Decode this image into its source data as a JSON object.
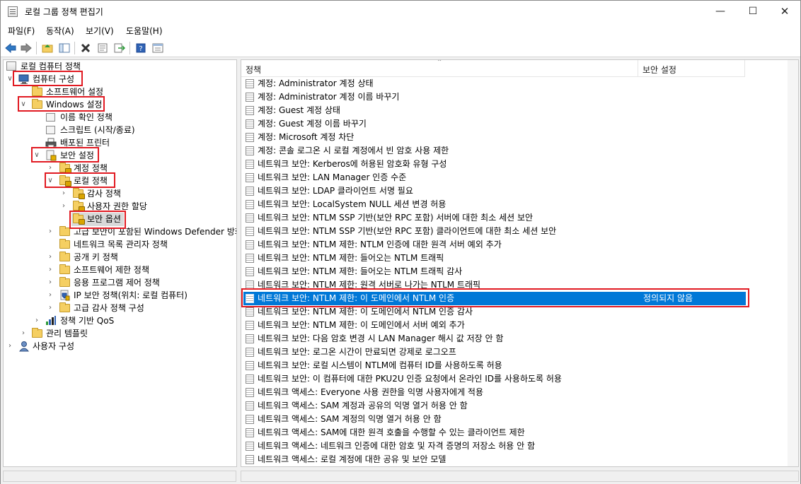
{
  "window": {
    "title": "로컬 그룹 정책 편집기"
  },
  "menu": [
    "파일(F)",
    "동작(A)",
    "보기(V)",
    "도움말(H)"
  ],
  "toolbar": {
    "icons": [
      "back-arrow-icon",
      "forward-arrow-icon",
      "up-folder-icon",
      "show-hide-tree-icon",
      "delete-icon",
      "properties-icon",
      "export-list-icon",
      "help-icon",
      "mmc-view-icon"
    ]
  },
  "tree": {
    "root": "로컬 컴퓨터 정책",
    "computer_config": "컴퓨터 구성",
    "software_settings": "소프트웨어 설정",
    "windows_settings": "Windows 설정",
    "name_resolution": "이름 확인 정책",
    "scripts": "스크립트 (시작/종료)",
    "deployed_printers": "배포된 프린터",
    "security_settings": "보안 설정",
    "account_policies": "계정 정책",
    "local_policies": "로컬 정책",
    "audit_policy": "감사 정책",
    "user_rights": "사용자 권한 할당",
    "security_options": "보안 옵션",
    "wf_advanced": "고급 보안이 포함된 Windows Defender 방화",
    "network_list": "네트워크 목록 관리자 정책",
    "public_key": "공개 키 정책",
    "software_restriction": "소프트웨어 제한 정책",
    "app_control": "응용 프로그램 제어 정책",
    "ipsec": "IP 보안 정책(위치: 로컬 컴퓨터)",
    "advanced_audit": "고급 감사 정책 구성",
    "qos": "정책 기반 QoS",
    "admin_templates": "관리 템플릿",
    "user_config": "사용자 구성"
  },
  "list": {
    "col_policy": "정책",
    "col_setting": "보안 설정",
    "rows": [
      {
        "label": "계정: Administrator 계정 상태",
        "value": ""
      },
      {
        "label": "계정: Administrator 계정 이름 바꾸기",
        "value": ""
      },
      {
        "label": "계정: Guest 계정 상태",
        "value": ""
      },
      {
        "label": "계정: Guest 계정 이름 바꾸기",
        "value": ""
      },
      {
        "label": "계정: Microsoft 계정 차단",
        "value": ""
      },
      {
        "label": "계정: 콘솔 로그온 시 로컬 계정에서 빈 암호 사용 제한",
        "value": ""
      },
      {
        "label": "네트워크 보안: Kerberos에 허용된 암호화 유형 구성",
        "value": ""
      },
      {
        "label": "네트워크 보안: LAN Manager 인증 수준",
        "value": ""
      },
      {
        "label": "네트워크 보안: LDAP 클라이언트 서명 필요",
        "value": ""
      },
      {
        "label": "네트워크 보안: LocalSystem NULL 세션 변경 허용",
        "value": ""
      },
      {
        "label": "네트워크 보안: NTLM SSP 기반(보안 RPC 포함) 서버에 대한 최소 세션 보안",
        "value": ""
      },
      {
        "label": "네트워크 보안: NTLM SSP 기반(보안 RPC 포함) 클라이언트에 대한 최소 세션 보안",
        "value": ""
      },
      {
        "label": "네트워크 보안: NTLM 제한: NTLM 인증에 대한 원격 서버 예외 추가",
        "value": ""
      },
      {
        "label": "네트워크 보안: NTLM 제한: 들어오는 NTLM 트래픽",
        "value": ""
      },
      {
        "label": "네트워크 보안: NTLM 제한: 들어오는 NTLM 트래픽 감사",
        "value": ""
      },
      {
        "label": "네트워크 보안: NTLM 제한: 원격 서버로 나가는 NTLM 트래픽",
        "value": ""
      },
      {
        "label": "네트워크 보안: NTLM 제한: 이 도메인에서 NTLM 인증",
        "value": "정의되지 않음"
      },
      {
        "label": "네트워크 보안: NTLM 제한: 이 도메인에서 NTLM 인증 감사",
        "value": ""
      },
      {
        "label": "네트워크 보안: NTLM 제한: 이 도메인에서 서버 예외 추가",
        "value": ""
      },
      {
        "label": "네트워크 보안: 다음 암호 변경 시 LAN Manager 해시 값 저장 안 함",
        "value": ""
      },
      {
        "label": "네트워크 보안: 로그온 시간이 만료되면 강제로 로그오프",
        "value": ""
      },
      {
        "label": "네트워크 보안: 로컬 시스템이 NTLM에 컴퓨터 ID를 사용하도록 허용",
        "value": ""
      },
      {
        "label": "네트워크 보안: 이 컴퓨터에 대한 PKU2U 인증 요청에서 온라인 ID를 사용하도록 허용",
        "value": ""
      },
      {
        "label": "네트워크 액세스: Everyone 사용 권한을 익명 사용자에게 적용",
        "value": ""
      },
      {
        "label": "네트워크 액세스: SAM 계정과 공유의 익명 열거 허용 안 함",
        "value": ""
      },
      {
        "label": "네트워크 액세스: SAM 계정의 익명 열거 허용 안 함",
        "value": ""
      },
      {
        "label": "네트워크 액세스: SAM에 대한 원격 호출을 수행할 수 있는 클라이언트 제한",
        "value": ""
      },
      {
        "label": "네트워크 액세스: 네트워크 인증에 대한 암호 및 자격 증명의 저장소 허용 안 함",
        "value": ""
      },
      {
        "label": "네트워크 액세스: 로컬 계정에 대한 공유 및 보안 모델",
        "value": ""
      }
    ]
  },
  "colors": {
    "selection": "#0078d7",
    "highlight_box": "#e11a22"
  }
}
